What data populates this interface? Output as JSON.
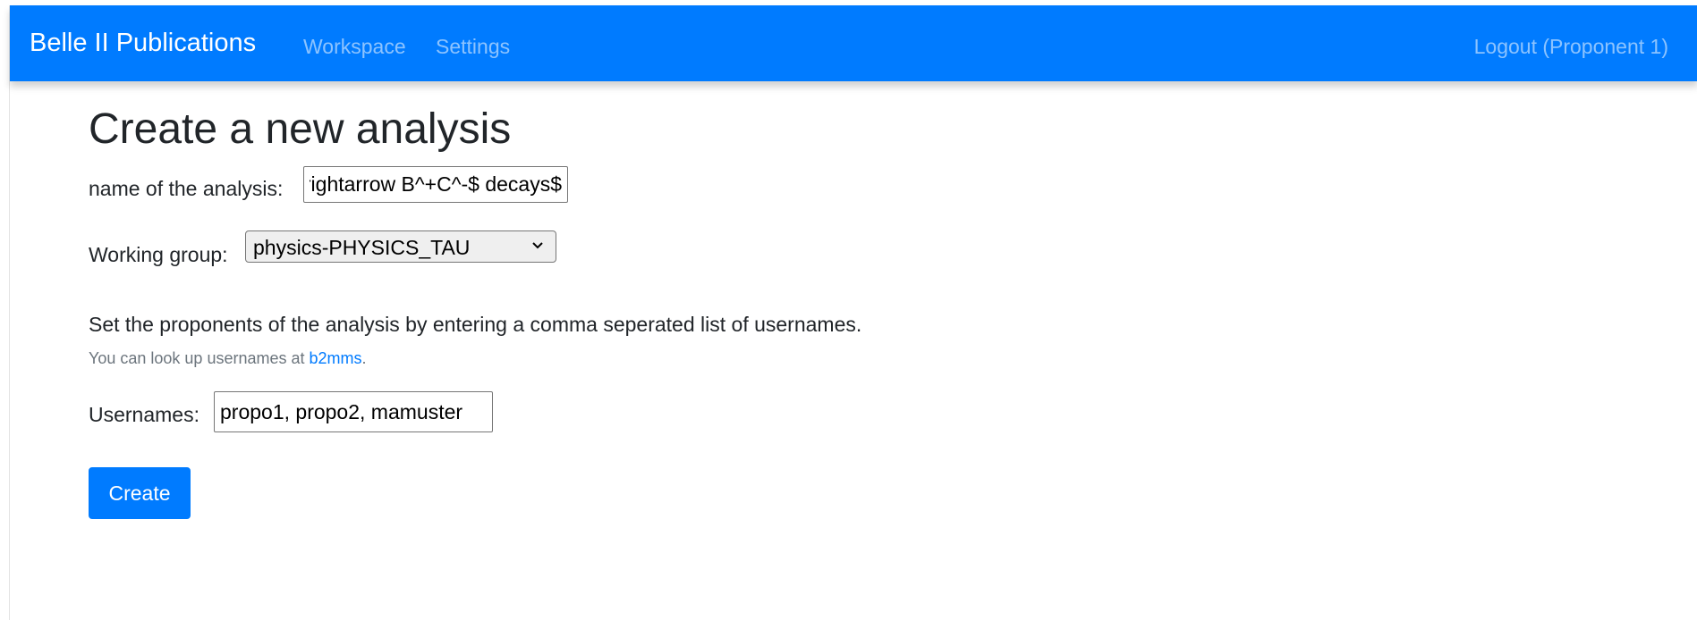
{
  "navbar": {
    "brand": "Belle II Publications",
    "links": [
      {
        "label": "Workspace"
      },
      {
        "label": "Settings"
      }
    ],
    "logout_label": "Logout (Proponent 1)",
    "color": "#007bff"
  },
  "page": {
    "title": "Create a new analysis"
  },
  "form": {
    "name_label": "name of the analysis:",
    "name_value": "$B^+\\rightarrow B^+C^-$ decays",
    "group_label": "Working group:",
    "group_selected": "physics-PHYSICS_TAU",
    "proponents_help": "Set the proponents of the analysis by entering a comma seperated list of usernames.",
    "lookup_prefix": "You can look up usernames at ",
    "lookup_link": "b2mms",
    "lookup_suffix": ".",
    "usernames_label": "Usernames:",
    "usernames_value": "propo1, propo2, mamuster",
    "create_label": "Create"
  },
  "icons": {
    "select_arrow": "chevron-down-icon"
  }
}
